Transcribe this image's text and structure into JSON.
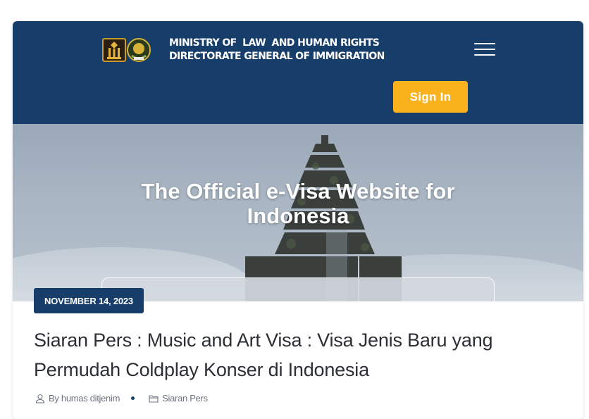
{
  "header": {
    "ministry_line1": "MINISTRY OF  LAW  AND HUMAN RIGHTS",
    "ministry_line2": "DIRECTORATE GENERAL OF IMMIGRATION",
    "signin_label": "Sign In",
    "menu_icon": "hamburger-icon"
  },
  "hero": {
    "title_line1": "The Official e-Visa Website for",
    "title_line2": "Indonesia"
  },
  "post": {
    "date": "NOVEMBER 14, 2023",
    "title": "Siaran Pers : Music and Art Visa : Visa Jenis Baru yang Permudah Coldplay Konser di Indonesia",
    "author": "By humas ditjenim",
    "category": "Siaran Pers"
  },
  "colors": {
    "navy": "#173d6b",
    "accent": "#f9b21b",
    "text": "#2c2f34",
    "meta": "#6c737f"
  }
}
